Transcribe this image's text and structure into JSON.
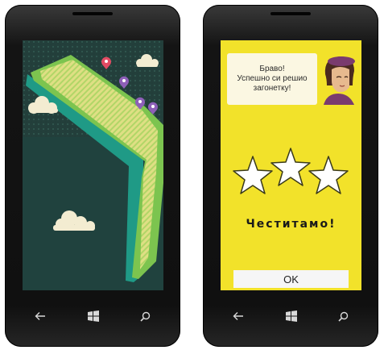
{
  "left_phone": {
    "screen": {
      "map_pins": [
        {
          "color": "#e24b63"
        },
        {
          "color": "#8d5fb7"
        },
        {
          "color": "#8d5fb7"
        },
        {
          "color": "#8d5fb7"
        },
        {
          "color": "#8d5fb7"
        },
        {
          "color": "#e24b63"
        }
      ]
    },
    "nav": {
      "back_icon": "back-arrow-icon",
      "start_icon": "windows-logo-icon",
      "search_icon": "search-icon"
    }
  },
  "right_phone": {
    "screen": {
      "background_color": "#f2e22a",
      "speech_bubble": {
        "line1": "Браво!",
        "line2": "Успешно си решио",
        "line3": "загонетку!"
      },
      "stars": {
        "earned": 3,
        "total": 3
      },
      "congrats_text": "Честитамо!",
      "ok_button_label": "OK"
    },
    "nav": {
      "back_icon": "back-arrow-icon",
      "start_icon": "windows-logo-icon",
      "search_icon": "search-icon"
    }
  }
}
